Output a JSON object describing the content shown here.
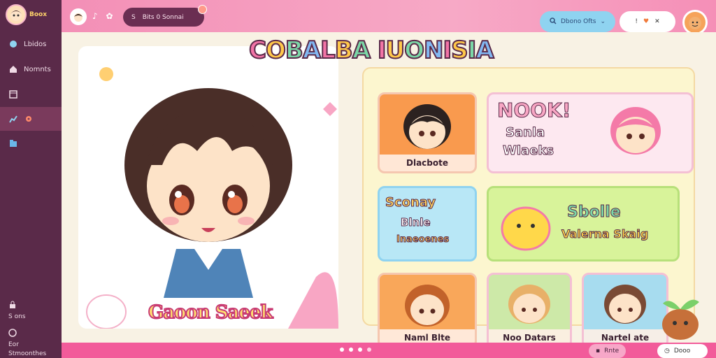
{
  "app": {
    "brand": "Boox"
  },
  "sidebar": {
    "items": [
      {
        "label": "Lbidos",
        "icon": "palette-icon"
      },
      {
        "label": "Nomnts",
        "icon": "home-icon"
      },
      {
        "label": "",
        "icon": "window-icon"
      },
      {
        "label": "",
        "icon": "chart-icon",
        "badge_icon": "gear-icon"
      },
      {
        "label": "",
        "icon": "folder-icon"
      }
    ],
    "bottom": [
      {
        "label": "S ons",
        "icon": "lock-icon"
      },
      {
        "label": "Eor Stmoonthes",
        "icon": "globe-icon"
      }
    ]
  },
  "topbar": {
    "icons_text": "♪ ✿",
    "search_text": "Bits 0 Sonnai",
    "search_icon_text": "S",
    "pill_blue_text": "Dbono Ofts",
    "pill_blue_arrow": "⌄",
    "pill_white_icons": [
      "!",
      "♥",
      "✕"
    ]
  },
  "main": {
    "page_title": [
      "C",
      "O",
      "B",
      "A",
      "L",
      "B",
      "A",
      " ",
      "I",
      "U",
      "O",
      "N",
      "I",
      "S",
      "I",
      "A"
    ],
    "hero_title": "Gaoon Saeek",
    "tiles": [
      {
        "label": "Dlacbote"
      },
      {
        "title": "NOOK!",
        "subtitle1": "Sanla",
        "subtitle2": "Wlaeks"
      },
      {
        "title": "Sconay",
        "subtitle1": "Blnle",
        "subtitle2": "Inaeoenes"
      },
      {
        "title": "Sbolle",
        "subtitle1": "Valerna Skaig"
      },
      {
        "label": "Naml Blte"
      },
      {
        "label": "Noo Datars"
      },
      {
        "label": "Nartel ate"
      }
    ]
  },
  "bottombar": {
    "btn1": "Rnte",
    "btn2": "Dooo"
  },
  "colors": {
    "sidebar": "#5a2a49",
    "topbar": "#f38fb6",
    "bottombar": "#f25b9a",
    "accent_yellow": "#ffe070"
  }
}
